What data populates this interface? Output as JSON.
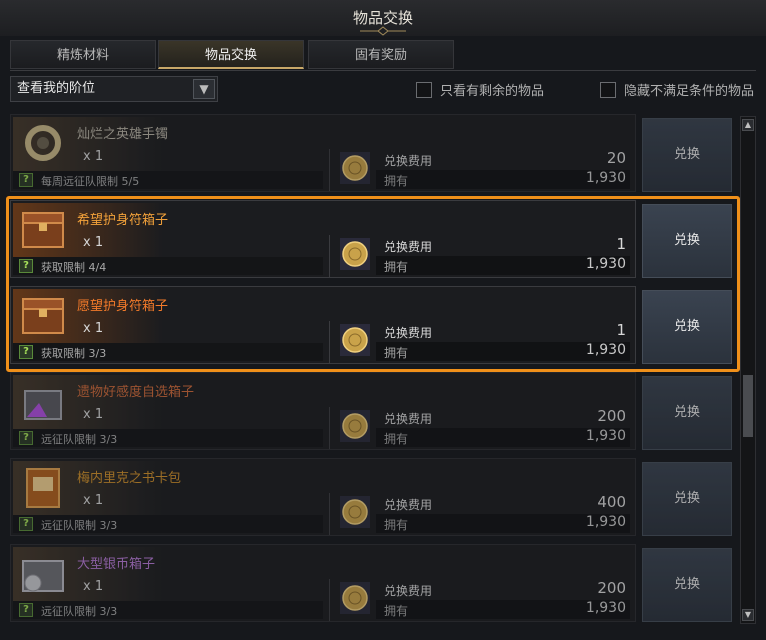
{
  "window": {
    "title": "物品交换"
  },
  "tabs": [
    {
      "label": "精炼材料",
      "active": false
    },
    {
      "label": "物品交换",
      "active": true
    },
    {
      "label": "固有奖励",
      "active": false
    }
  ],
  "filter": {
    "dropdown_value": "查看我的阶位",
    "checkbox_remaining": "只看有剩余的物品",
    "checkbox_hide_unmet": "隐藏不满足条件的物品"
  },
  "items": [
    {
      "name": "灿烂之英雄手镯",
      "qty": "x 1",
      "limit": "每周远征队限制 5/5",
      "cost_label": "兑换费用",
      "cost": "20",
      "own_label": "拥有",
      "own": "1,930",
      "button": "兑换",
      "name_color": "#b9b3a6",
      "icon": "bracelet-icon"
    },
    {
      "name": "希望护身符箱子",
      "qty": "x 1",
      "limit": "获取限制 4/4",
      "cost_label": "兑换费用",
      "cost": "1",
      "own_label": "拥有",
      "own": "1,930",
      "button": "兑换",
      "name_color": "#f2a13a",
      "icon": "chest-icon"
    },
    {
      "name": "愿望护身符箱子",
      "qty": "x 1",
      "limit": "获取限制 3/3",
      "cost_label": "兑换费用",
      "cost": "1",
      "own_label": "拥有",
      "own": "1,930",
      "button": "兑换",
      "name_color": "#f27a2a",
      "icon": "chest-icon"
    },
    {
      "name": "遗物好感度自选箱子",
      "qty": "x 1",
      "limit": "远征队限制 3/3",
      "cost_label": "兑换费用",
      "cost": "200",
      "own_label": "拥有",
      "own": "1,930",
      "button": "兑换",
      "name_color": "#d06a3a",
      "icon": "gift-box-icon"
    },
    {
      "name": "梅内里克之书卡包",
      "qty": "x 1",
      "limit": "远征队限制 3/3",
      "cost_label": "兑换费用",
      "cost": "400",
      "own_label": "拥有",
      "own": "1,930",
      "button": "兑换",
      "name_color": "#d0902a",
      "icon": "book-icon"
    },
    {
      "name": "大型银币箱子",
      "qty": "x 1",
      "limit": "远征队限制 3/3",
      "cost_label": "兑换费用",
      "cost": "200",
      "own_label": "拥有",
      "own": "1,930",
      "button": "兑换",
      "name_color": "#b77ad6",
      "icon": "silver-chest-icon"
    }
  ]
}
